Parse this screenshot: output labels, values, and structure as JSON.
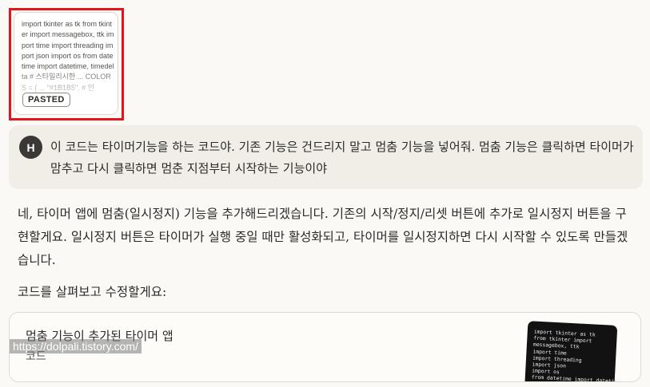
{
  "pasted": {
    "text": "import tkinter as tk from tkinter import messagebox, ttk import time import threading import json import os from datetime import datetime, timedelta # 스타일리시한 ... COLORS = { ... \"#1B1B5\", # 인",
    "badge": "PASTED"
  },
  "user_message": {
    "avatar_initial": "H",
    "text": "이 코드는 타이머기능을 하는 코드야. 기존 기능은 건드리지 말고 멈춤 기능을 넣어줘. 멈춤 기능은 클릭하면 타이머가 맘추고 다시 클릭하면 멈춘 지점부터 시작하는 기능이야"
  },
  "assistant": {
    "paragraph": "네, 타이머 앱에 멈춤(일시정지) 기능을 추가해드리겠습니다. 기존의 시작/정지/리셋 버튼에 추가로 일시정지 버튼을 구현할게요. 일시정지 버튼은 타이머가 실행 중일 때만 활성화되고, 타이머를 일시정지하면 다시 시작할 수 있도록 만들겠습니다.",
    "lead": "코드를 살펴보고 수정할게요:"
  },
  "artifact": {
    "title": "멈춤 기능이 추가된 타이머 앱",
    "subtitle": "코드",
    "thumb_code": "import tkinter as tk\nfrom tkinter import\nmessagebox, ttk\nimport time\nimport threading\nimport json\nimport os\nfrom datetime import datetime,\ntimedelta"
  },
  "watermark": "https://dolpali.tistory.com/"
}
